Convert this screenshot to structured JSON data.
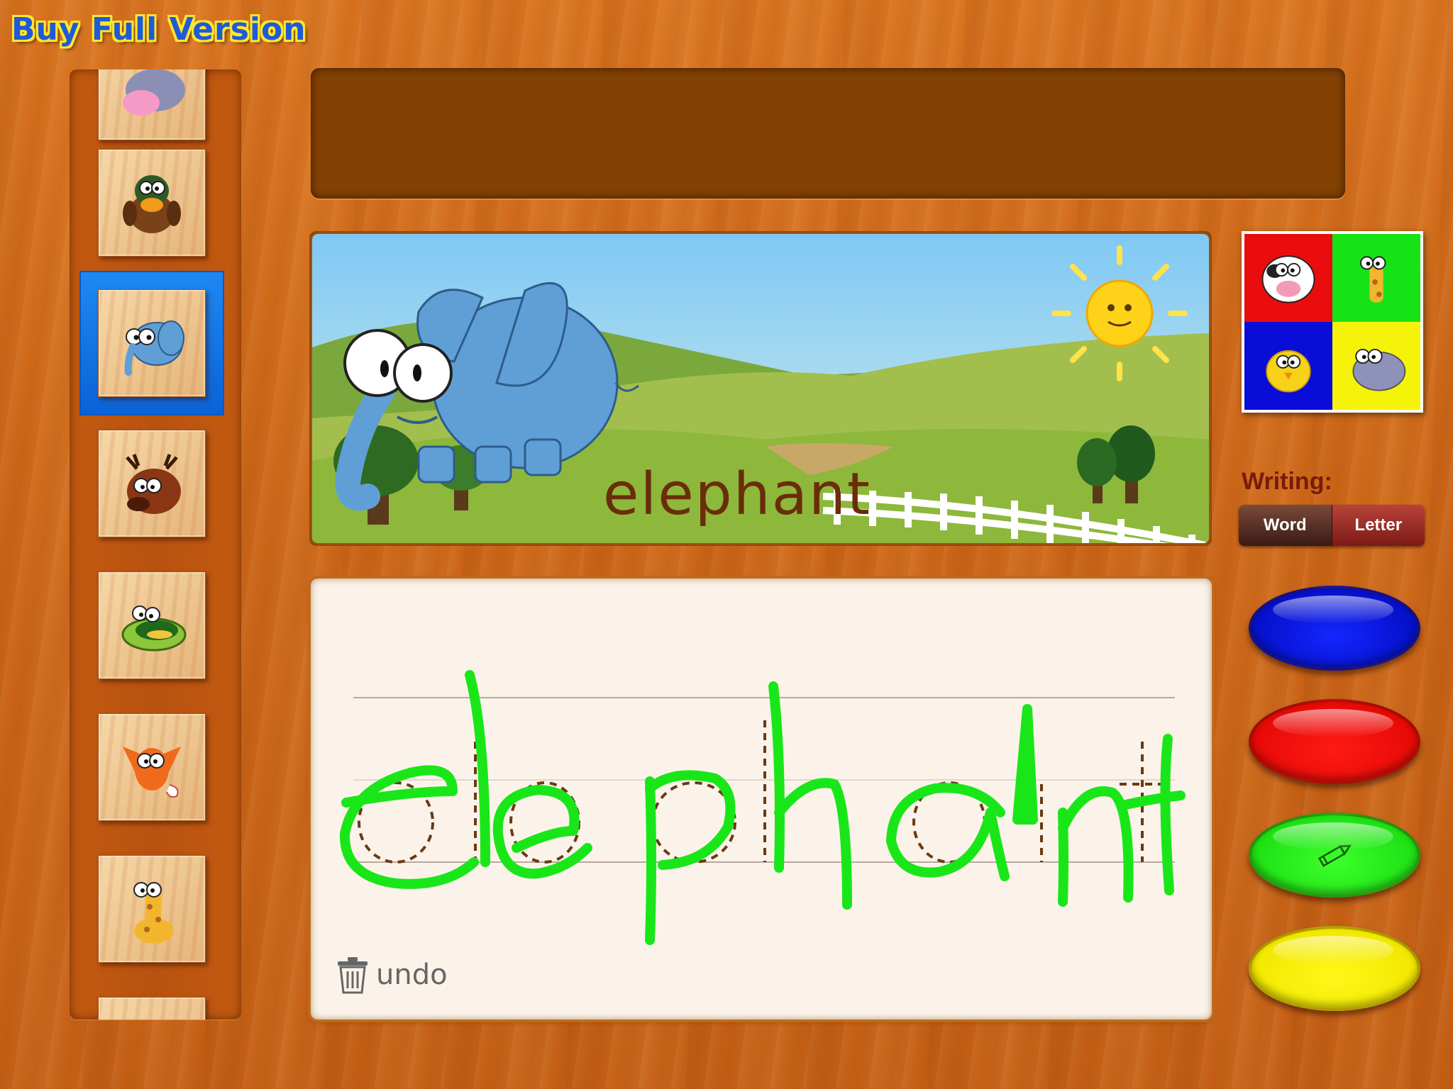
{
  "header": {
    "buy_label": "Buy Full Version"
  },
  "sidebar": {
    "items": [
      {
        "animal": "hippo",
        "icon": "hippo-icon"
      },
      {
        "animal": "duck",
        "icon": "duck-icon"
      },
      {
        "animal": "elephant",
        "icon": "elephant-icon",
        "selected": true
      },
      {
        "animal": "moose",
        "icon": "moose-icon"
      },
      {
        "animal": "turtle",
        "icon": "turtle-icon"
      },
      {
        "animal": "fox",
        "icon": "fox-icon"
      },
      {
        "animal": "giraffe",
        "icon": "giraffe-icon"
      }
    ]
  },
  "picture": {
    "word": "elephant"
  },
  "board": {
    "undo_label": "undo",
    "trace_word": "elephant"
  },
  "puzzle": {
    "colors": [
      "#e90d0d",
      "#16e316",
      "#0a0cd8",
      "#f6f30b"
    ],
    "icons": [
      "cow-icon",
      "giraffe-icon",
      "chick-icon",
      "hippo-icon"
    ]
  },
  "writing": {
    "label": "Writing:",
    "word_label": "Word",
    "letter_label": "Letter"
  },
  "palette": {
    "colors": [
      "#0a14e8",
      "#ee0d08",
      "#22e418",
      "#f4ea00"
    ],
    "selected": "green"
  }
}
